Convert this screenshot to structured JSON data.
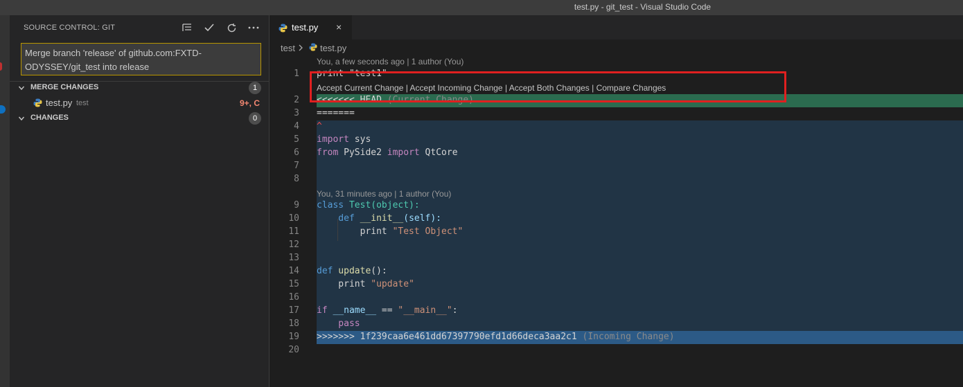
{
  "window": {
    "title": "test.py - git_test - Visual Studio Code"
  },
  "sidebar": {
    "title": "SOURCE CONTROL: GIT",
    "commit_message": "Merge branch 'release' of github.com:FXTD-ODYSSEY/git_test into release",
    "groups": [
      {
        "label": "MERGE CHANGES",
        "count": "1"
      },
      {
        "label": "CHANGES",
        "count": "0"
      }
    ],
    "merge_file": {
      "name": "test.py",
      "dir": "test",
      "status": "9+, C"
    }
  },
  "tab": {
    "name": "test.py",
    "close": "×"
  },
  "breadcrumb": {
    "folder": "test",
    "file": "test.py"
  },
  "editor": {
    "lens1": "You, a few seconds ago | 1 author (You)",
    "lens2": "You, 31 minutes ago | 1 author (You)",
    "merge_actions": "Accept Current Change | Accept Incoming Change | Accept Both Changes | Compare Changes",
    "lines": {
      "l1": "print \"test1\"",
      "l2_marker": "<<<<<<< HEAD",
      "l2_note": "(Current Change)",
      "l3": "=======",
      "l4": "^",
      "l5_kw": "import",
      "l5_rest": " sys",
      "l6_from": "from",
      "l6_mod": " PySide2 ",
      "l6_import": "import",
      "l6_rest": " QtCore",
      "l9_kw": "class",
      "l9_name": " Test",
      "l9_rest": "(object):",
      "l10_kw": "    def",
      "l10_name": " __init__",
      "l10_rest": "(self):",
      "l11_kw": "        print",
      "l11_str": " \"Test Object\"",
      "l14_kw": "def",
      "l14_name": " update",
      "l14_rest": "():",
      "l15_kw": "    print",
      "l15_str": " \"update\"",
      "l17_kw": "if",
      "l17_var": " __name__",
      "l17_op": " == ",
      "l17_str": "\"__main__\"",
      "l17_rest": ":",
      "l18_kw": "    pass",
      "l19_marker": ">>>>>>> 1f239caa6e461dd67397790efd1d66deca3aa2c1",
      "l19_note": "(Incoming Change)"
    },
    "line_numbers": [
      "1",
      "2",
      "3",
      "4",
      "5",
      "6",
      "7",
      "8",
      "9",
      "10",
      "11",
      "12",
      "13",
      "14",
      "15",
      "16",
      "17",
      "18",
      "19",
      "20"
    ]
  },
  "colors": {
    "current_change_bg": "#2b6b4f",
    "incoming_change_bg": "#213445",
    "highlight_box": "#e02020",
    "commit_box_border": "#b89500"
  },
  "icons": [
    "python-file-icon",
    "chevron-down-icon",
    "chevron-right-icon",
    "list-icon",
    "check-icon",
    "refresh-icon",
    "ellipsis-icon",
    "close-icon"
  ]
}
